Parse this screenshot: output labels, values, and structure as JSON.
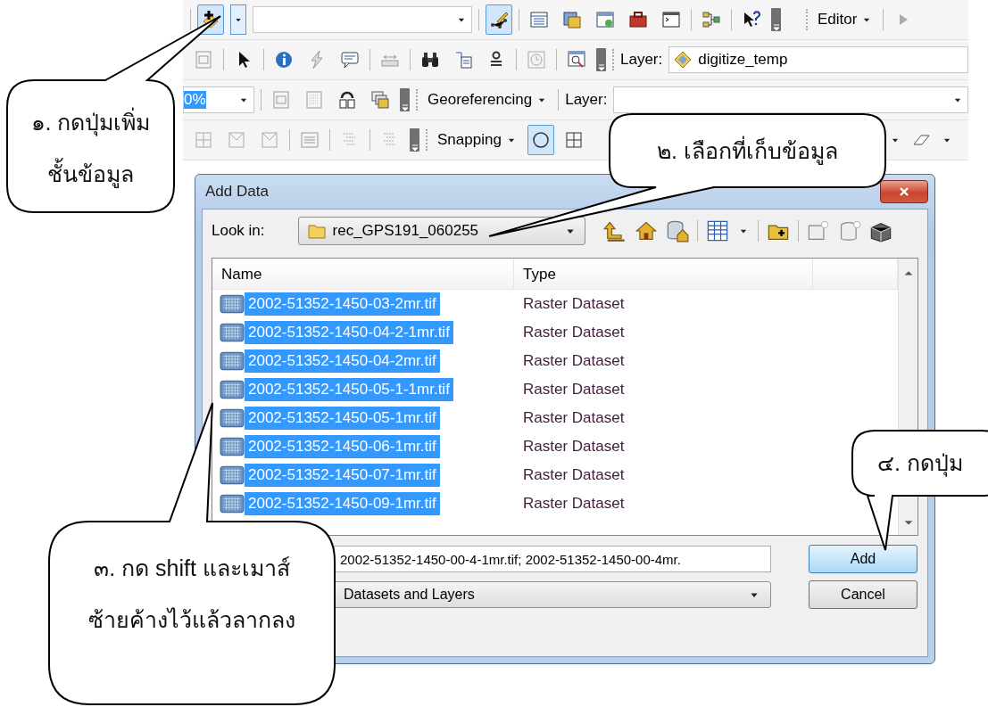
{
  "toolbar": {
    "add_data_button": {
      "selected": true
    },
    "edit_tool_button": {
      "selected": true
    },
    "editor_menu": "Editor",
    "layer_label": "Layer:",
    "layer_value": "digitize_temp",
    "scale_value": "0%",
    "georeferencing_menu": "Georeferencing",
    "georef_layer_label": "Layer:",
    "snapping_menu": "Snapping",
    "snap_point_button": {
      "selected": true
    }
  },
  "dialog": {
    "title": "Add Data",
    "look_in": {
      "label": "Look in:",
      "value": "rec_GPS191_060255"
    },
    "columns": [
      "Name",
      "Type"
    ],
    "rows": [
      {
        "name": "2002-51352-1450-03-2mr.tif",
        "type": "Raster Dataset",
        "selected": true
      },
      {
        "name": "2002-51352-1450-04-2-1mr.tif",
        "type": "Raster Dataset",
        "selected": true
      },
      {
        "name": "2002-51352-1450-04-2mr.tif",
        "type": "Raster Dataset",
        "selected": true
      },
      {
        "name": "2002-51352-1450-05-1-1mr.tif",
        "type": "Raster Dataset",
        "selected": true
      },
      {
        "name": "2002-51352-1450-05-1mr.tif",
        "type": "Raster Dataset",
        "selected": true
      },
      {
        "name": "2002-51352-1450-06-1mr.tif",
        "type": "Raster Dataset",
        "selected": true
      },
      {
        "name": "2002-51352-1450-07-1mr.tif",
        "type": "Raster Dataset",
        "selected": true
      },
      {
        "name": "2002-51352-1450-09-1mr.tif",
        "type": "Raster Dataset",
        "selected": true
      }
    ],
    "file_name": "2002-51352-1450-00-4-1mr.tif; 2002-51352-1450-00-4mr.",
    "file_type": "Datasets and Layers",
    "buttons": [
      {
        "label": "Add",
        "default": true
      },
      {
        "label": "Cancel",
        "default": false
      }
    ]
  },
  "callouts": [
    {
      "text": "๑. กดปุ่มเพิ่ม\nชั้นข้อมูล"
    },
    {
      "text": "๒. เลือกที่เก็บข้อมูล"
    },
    {
      "text": "๓. กด shift และเมาส์\nซ้ายค้างไว้แล้วลากลง"
    },
    {
      "text": "๔. กดปุ่ม"
    }
  ]
}
